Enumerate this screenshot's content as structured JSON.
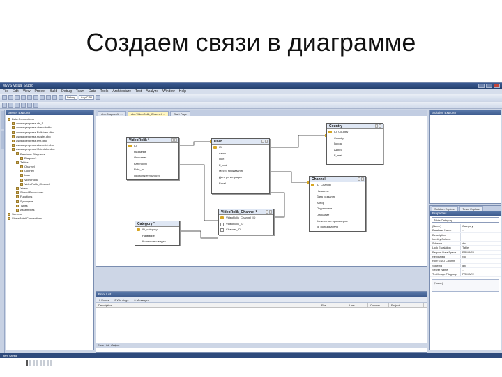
{
  "slide_title": "Создаем связи в диаграмме",
  "app": {
    "window_title": "MyVS  Visual Studio"
  },
  "menu": [
    "File",
    "Edit",
    "View",
    "Project",
    "Build",
    "Debug",
    "Team",
    "Data",
    "Tools",
    "Architecture",
    "Test",
    "Analyze",
    "Window",
    "Help"
  ],
  "toolbar": {
    "config_value": "Debug",
    "platform_value": "Any CPU"
  },
  "server_explorer": {
    "title": "Server Explorer",
    "items": [
      "Data Connections",
      "asus\\sqlexpress.db_1",
      "asus\\sqlexpress.videodb.dbo",
      "asus\\sqlexpress.Rollvideo.dbo",
      "asus\\sqlexpress.master.dbo",
      "asus\\sqlexpress.test.dbo",
      "asus\\sqlexpress.videodb1.dbo",
      "asus\\sqlexpress.Videotube.dbo",
      "Database Diagrams",
      "Diagram1",
      "Tables",
      "Channel",
      "Country",
      "User",
      "VideoRolik",
      "VideoRolik_Channel",
      "Views",
      "Stored Procedures",
      "Functions",
      "Synonyms",
      "Types",
      "Assemblies",
      "Servers",
      "SharePoint Connections"
    ]
  },
  "doc_tabs": [
    "dbo.Diagram1: ...",
    "dbo.VideoRolik_Channel: ...",
    "Start Page"
  ],
  "tables": {
    "videorolik": {
      "title": "VideoRolik *",
      "rows": [
        "ID",
        "Название",
        "Описание",
        "Категория",
        "Rate_av",
        "Продолжительность"
      ]
    },
    "user": {
      "title": "User",
      "rows": [
        "ID",
        "name",
        "Пол",
        "E_mail",
        "Место проживания",
        "Дата регистрации",
        "Email"
      ]
    },
    "country": {
      "title": "Country",
      "rows": [
        "ID_Country",
        "Country",
        "Город",
        "Адрес",
        "E_mail"
      ]
    },
    "channel": {
      "title": "Channel",
      "rows": [
        "ID_Channel",
        "Название",
        "Дата создания",
        "Автор",
        "Подписчики",
        "Описание",
        "Количество просмотров",
        "Id_пользователя"
      ]
    },
    "videorolik_channel": {
      "title": "VideoRolik_Channel *",
      "rows": [
        "VideoRolik_Channel_ID",
        "VideoRolik_ID",
        "Channel_ID"
      ]
    },
    "category": {
      "title": "Category *",
      "rows": [
        "ID_category",
        "Название",
        "Количество видео"
      ]
    }
  },
  "error_list": {
    "title": "Error List",
    "filters": [
      "0 Errors",
      "0 Warnings",
      "0 Messages"
    ],
    "columns": [
      "Description",
      "File",
      "Line",
      "Column",
      "Project"
    ]
  },
  "bottom_tabs": [
    "Error List",
    "Output"
  ],
  "status": "Item Saved",
  "text_explorer": {
    "title": "Solution Explorer"
  },
  "properties": {
    "title": "Properties",
    "tabs": [
      "Solution Explorer",
      "Team Explorer"
    ],
    "selected": "Table Category",
    "rows": [
      [
        "(Name)",
        "Category"
      ],
      [
        "Database Name",
        "..."
      ],
      [
        "Description",
        ""
      ],
      [
        "Identity Column",
        ""
      ],
      [
        "Schema",
        "dbo"
      ],
      [
        "Lock Escalation",
        "Table"
      ],
      [
        "Regular Data Space",
        "PRIMARY"
      ],
      [
        "Replicated",
        "No"
      ],
      [
        "Row GUID Column",
        ""
      ],
      [
        "Schema",
        "dbo"
      ],
      [
        "Server Name",
        "..."
      ],
      [
        "Text/Image Filegroup",
        "PRIMARY"
      ]
    ],
    "description_label": "(Name)"
  }
}
